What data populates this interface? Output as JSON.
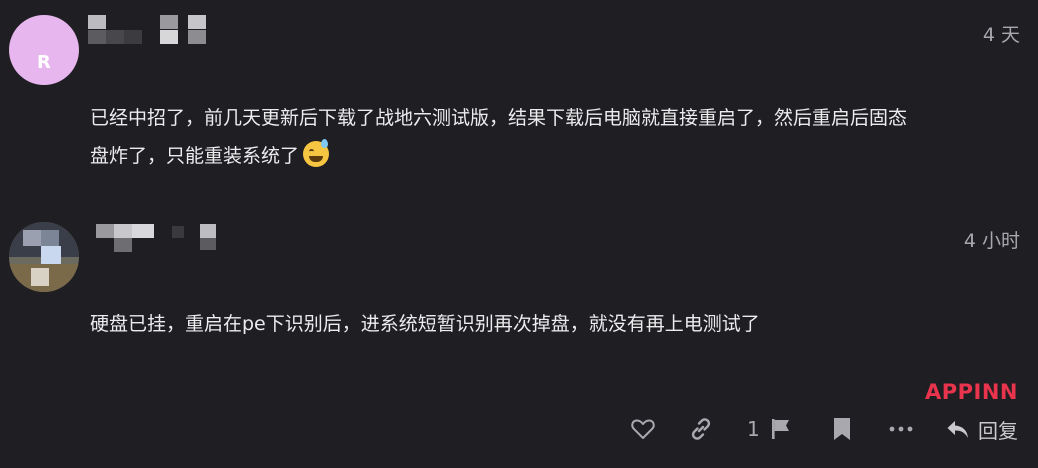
{
  "posts": [
    {
      "time": "4 天",
      "avatar_letter": "R",
      "content_line1": "已经中招了，前几天更新后下载了战地六测试版，结果下载后电脑就直接重启了，然后重启后固态",
      "content_line2": "盘炸了，只能重装系统了"
    },
    {
      "time": "4 小时",
      "content": "硬盘已挂，重启在pe下识别后，进系统短暂识别再次掉盘，就没有再上电测试了"
    }
  ],
  "watermark": "APPINN",
  "actions": {
    "like_count": "1",
    "reply_label": "回复"
  },
  "colors": {
    "background": "#1f1e22",
    "avatar1_bg": "#e7b6ee",
    "watermark": "#e8344c",
    "muted": "#a8a8ae"
  }
}
